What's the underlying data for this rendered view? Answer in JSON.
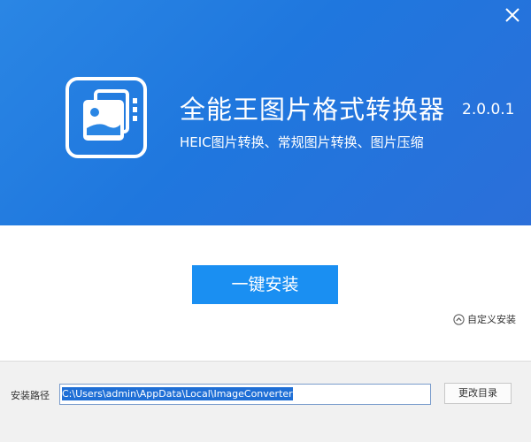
{
  "window": {
    "close_icon": "close-icon",
    "accent_color": "#1a8ff2",
    "header_color": "#2a86e4"
  },
  "header": {
    "app_icon": "image-gallery-icon",
    "title": "全能王图片格式转换器",
    "version": "2.0.0.1",
    "subtitle": "HEIC图片转换、常规图片转换、图片压缩"
  },
  "main": {
    "install_label": "一键安装",
    "custom_install_label": "自定义安装",
    "custom_install_icon": "chevron-up-circle-icon"
  },
  "footer": {
    "path_label": "安装路径",
    "path_value": "C:\\Users\\admin\\AppData\\Local\\ImageConverter",
    "change_dir_label": "更改目录"
  }
}
